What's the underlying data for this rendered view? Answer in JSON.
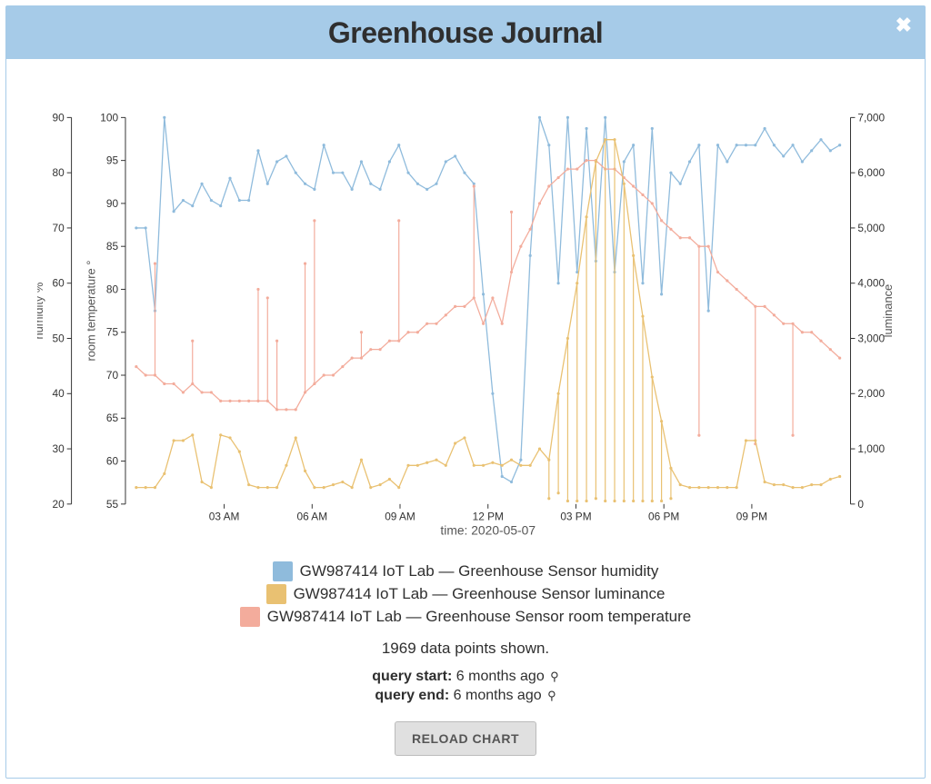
{
  "header": {
    "title": "Greenhouse Journal"
  },
  "legend": {
    "items": [
      {
        "label": "GW987414 IoT Lab — Greenhouse Sensor humidity",
        "color": "#8fbbdc"
      },
      {
        "label": "GW987414 IoT Lab — Greenhouse Sensor luminance",
        "color": "#e9c172"
      },
      {
        "label": "GW987414 IoT Lab — Greenhouse Sensor room temperature",
        "color": "#f3ac9c"
      }
    ]
  },
  "info": {
    "datapoints_label": "1969 data points shown.",
    "query_start_label": "query start:",
    "query_start_value": "6 months ago",
    "query_end_label": "query end:",
    "query_end_value": "6 months ago",
    "reload_label": "RELOAD CHART"
  },
  "chart_data": {
    "type": "line",
    "x_time_label": "time: 2020-05-07",
    "x_ticks": [
      "03 AM",
      "06 AM",
      "09 AM",
      "12 PM",
      "03 PM",
      "06 PM",
      "09 PM"
    ],
    "axes": [
      {
        "id": "humidity",
        "label": "humidity %",
        "side": "left-outer",
        "min": 20,
        "max": 90,
        "ticks": [
          20,
          30,
          40,
          50,
          60,
          70,
          80,
          90
        ],
        "color": "#8fbbdc"
      },
      {
        "id": "temp",
        "label": "room temperature °",
        "side": "left-inner",
        "min": 55,
        "max": 100,
        "ticks": [
          55,
          60,
          65,
          70,
          75,
          80,
          85,
          90,
          95,
          100
        ],
        "color": "#f3ac9c"
      },
      {
        "id": "luminance",
        "label": "luminance",
        "side": "right",
        "min": 0,
        "max": 7000,
        "ticks": [
          0,
          1000,
          2000,
          3000,
          4000,
          5000,
          6000,
          7000
        ],
        "color": "#e9c172"
      }
    ],
    "series": [
      {
        "name": "Greenhouse Sensor humidity",
        "axis": "humidity",
        "color": "#8fbbdc",
        "values": [
          70,
          70,
          55,
          90,
          73,
          75,
          74,
          78,
          75,
          74,
          79,
          75,
          75,
          84,
          78,
          82,
          83,
          80,
          78,
          77,
          85,
          80,
          80,
          77,
          82,
          78,
          77,
          82,
          85,
          80,
          78,
          77,
          78,
          82,
          83,
          80,
          78,
          58,
          40,
          25,
          24,
          28,
          65,
          90,
          85,
          60,
          90,
          62,
          88,
          64,
          90,
          62,
          82,
          85,
          60,
          88,
          58,
          80,
          78,
          82,
          85,
          55,
          85,
          82,
          85,
          85,
          85,
          88,
          85,
          83,
          85,
          82,
          84,
          86,
          84,
          85
        ]
      },
      {
        "name": "Greenhouse Sensor room temperature",
        "axis": "temp",
        "color": "#f3ac9c",
        "values": [
          71,
          70,
          70,
          69,
          69,
          68,
          69,
          68,
          68,
          67,
          67,
          67,
          67,
          67,
          67,
          66,
          66,
          66,
          68,
          69,
          70,
          70,
          71,
          72,
          72,
          73,
          73,
          74,
          74,
          75,
          75,
          76,
          76,
          77,
          78,
          78,
          79,
          76,
          79,
          76,
          82,
          85,
          87,
          90,
          92,
          93,
          94,
          94,
          95,
          95,
          94,
          94,
          93,
          92,
          91,
          90,
          88,
          87,
          86,
          86,
          85,
          85,
          82,
          81,
          80,
          79,
          78,
          78,
          77,
          76,
          76,
          75,
          75,
          74,
          73,
          72
        ],
        "spikes": [
          [
            2,
            83
          ],
          [
            6,
            74
          ],
          [
            13,
            80
          ],
          [
            14,
            79
          ],
          [
            15,
            74
          ],
          [
            18,
            83
          ],
          [
            19,
            88
          ],
          [
            24,
            75
          ],
          [
            28,
            88
          ],
          [
            36,
            92
          ],
          [
            40,
            89
          ],
          [
            60,
            63
          ],
          [
            66,
            62
          ],
          [
            70,
            63
          ]
        ]
      },
      {
        "name": "Greenhouse Sensor luminance",
        "axis": "luminance",
        "color": "#e9c172",
        "values": [
          300,
          300,
          300,
          550,
          1150,
          1150,
          1250,
          400,
          300,
          1250,
          1200,
          950,
          350,
          300,
          300,
          300,
          700,
          1200,
          600,
          300,
          300,
          350,
          400,
          300,
          800,
          300,
          350,
          450,
          300,
          700,
          700,
          750,
          800,
          700,
          1100,
          1200,
          700,
          700,
          750,
          700,
          800,
          700,
          700,
          1000,
          800,
          2000,
          3000,
          4000,
          5200,
          6200,
          6600,
          6600,
          5800,
          4500,
          3400,
          2300,
          1500,
          650,
          350,
          300,
          300,
          300,
          300,
          300,
          300,
          1150,
          1150,
          400,
          350,
          350,
          300,
          300,
          350,
          350,
          450,
          500
        ],
        "spikes": [
          [
            44,
            100
          ],
          [
            45,
            200
          ],
          [
            46,
            56
          ],
          [
            47,
            56
          ],
          [
            48,
            56
          ],
          [
            49,
            100
          ],
          [
            50,
            56
          ],
          [
            51,
            56
          ],
          [
            52,
            56
          ],
          [
            53,
            56
          ],
          [
            54,
            56
          ],
          [
            55,
            56
          ],
          [
            56,
            56
          ],
          [
            57,
            100
          ]
        ]
      }
    ]
  }
}
